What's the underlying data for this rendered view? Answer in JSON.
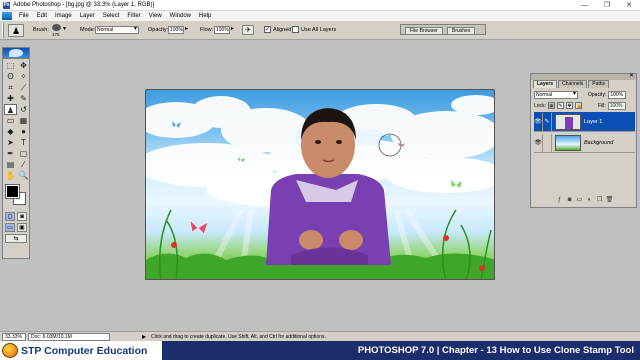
{
  "window": {
    "title": "Adobe Photoshop - [bg.jpg @ 33.3% (Layer 1, RGB)]",
    "controls": [
      "—",
      "❐",
      "✕"
    ]
  },
  "menu": [
    "File",
    "Edit",
    "Image",
    "Layer",
    "Select",
    "Filter",
    "View",
    "Window",
    "Help"
  ],
  "options": {
    "brush_label": "Brush:",
    "brush_size": "175",
    "mode_label": "Mode:",
    "mode_value": "Normal",
    "opacity_label": "Opacity:",
    "opacity_value": "100%",
    "flow_label": "Flow:",
    "flow_value": "100%",
    "aligned_label": "Aligned",
    "aligned_checked": true,
    "use_all_layers_label": "Use All Layers",
    "use_all_layers_checked": false,
    "well_tabs": [
      "File Browser",
      "Brushes"
    ]
  },
  "toolbox": {
    "tools": [
      {
        "name": "marquee-tool",
        "glyph": "⬚"
      },
      {
        "name": "move-tool",
        "glyph": "✥"
      },
      {
        "name": "lasso-tool",
        "glyph": "ʘ"
      },
      {
        "name": "magic-wand-tool",
        "glyph": "✧"
      },
      {
        "name": "crop-tool",
        "glyph": "⌗"
      },
      {
        "name": "slice-tool",
        "glyph": "⟋"
      },
      {
        "name": "healing-brush-tool",
        "glyph": "✚"
      },
      {
        "name": "brush-tool",
        "glyph": "✎"
      },
      {
        "name": "clone-stamp-tool",
        "glyph": "♟"
      },
      {
        "name": "history-brush-tool",
        "glyph": "↺"
      },
      {
        "name": "eraser-tool",
        "glyph": "▭"
      },
      {
        "name": "gradient-tool",
        "glyph": "▦"
      },
      {
        "name": "blur-tool",
        "glyph": "◆"
      },
      {
        "name": "dodge-tool",
        "glyph": "●"
      },
      {
        "name": "path-selection-tool",
        "glyph": "➤"
      },
      {
        "name": "type-tool",
        "glyph": "T"
      },
      {
        "name": "pen-tool",
        "glyph": "✒"
      },
      {
        "name": "shape-tool",
        "glyph": "▢"
      },
      {
        "name": "notes-tool",
        "glyph": "▤"
      },
      {
        "name": "eyedropper-tool",
        "glyph": "⁄"
      },
      {
        "name": "hand-tool",
        "glyph": "✋"
      },
      {
        "name": "zoom-tool",
        "glyph": "🔍"
      }
    ],
    "active_tool": "clone-stamp-tool"
  },
  "layers_panel": {
    "tabs": [
      "Layers",
      "Channels",
      "Paths"
    ],
    "blend_mode": "Normal",
    "opacity_label": "Opacity:",
    "opacity_value": "100%",
    "lock_label": "Lock:",
    "fill_label": "Fill:",
    "fill_value": "100%",
    "layers": [
      {
        "name": "Layer 1",
        "visible": true,
        "selected": true
      },
      {
        "name": "Background",
        "visible": true,
        "selected": false
      }
    ],
    "footer_icons": [
      "layer-style-icon",
      "mask-icon",
      "new-set-icon",
      "adjustment-layer-icon",
      "new-layer-icon",
      "trash-icon"
    ]
  },
  "status": {
    "zoom": "33.33%",
    "doc_info": "Doc: 6.03M/10.1M",
    "hint": "Click and drag to create duplicate. Use Shift, Alt, and Ctrl for additional options."
  },
  "caption": {
    "brand": "STP Computer Education",
    "lesson": "PHOTOSHOP 7.0 | Chapter - 13 How to Use Clone Stamp Tool"
  },
  "colors": {
    "title_bar": "#ffffff",
    "ui_gray": "#d4d0c8",
    "selection_blue": "#0a4fb4",
    "caption_navy": "#1c2d6e",
    "sweater_purple": "#7a3fb0"
  }
}
